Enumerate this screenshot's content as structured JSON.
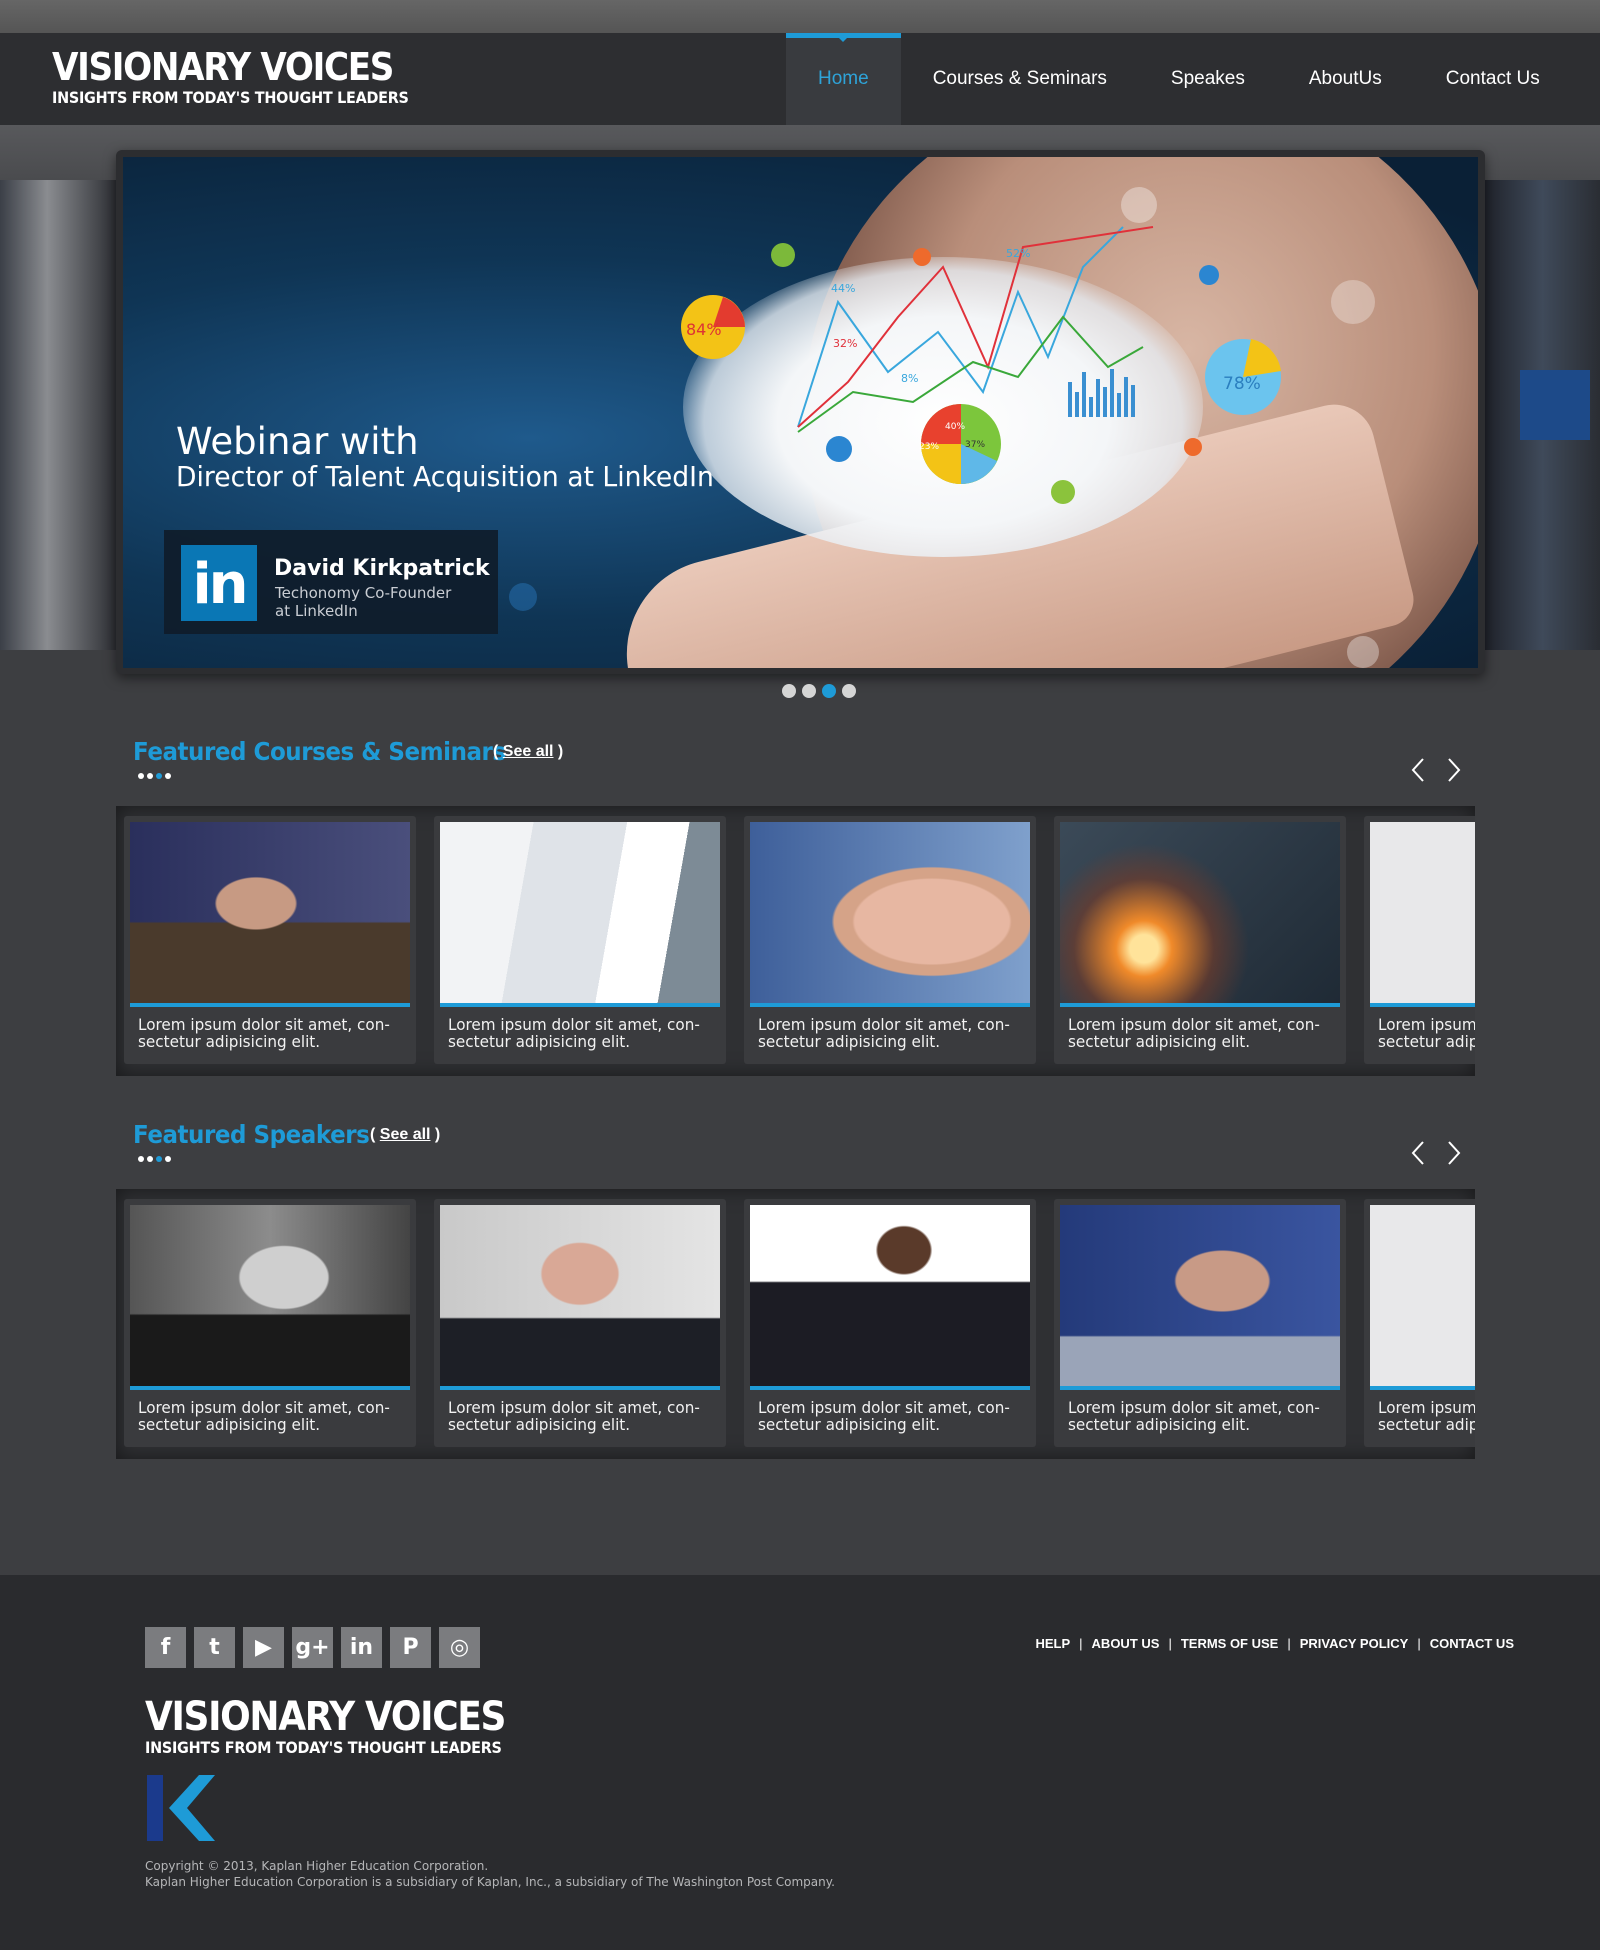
{
  "brand": {
    "title": "VISIONARY VOICES",
    "tagline": "INSIGHTS FROM TODAY'S THOUGHT LEADERS"
  },
  "nav": {
    "items": [
      {
        "label": "Home",
        "active": true
      },
      {
        "label": "Courses & Seminars",
        "active": false
      },
      {
        "label": "Speakes",
        "active": false
      },
      {
        "label": "AboutUs",
        "active": false
      },
      {
        "label": "Contact Us",
        "active": false
      }
    ]
  },
  "hero": {
    "title": "Webinar with",
    "subtitle": "Director of Talent Acquisition at LinkedIn",
    "badge_text": "in",
    "speaker_name": "David Kirkpatrick",
    "speaker_role": "Techonomy Co-Founder\nat LinkedIn",
    "chart_labels": [
      "84%",
      "78%",
      "44%",
      "52%",
      "32%",
      "8%",
      "40%",
      "23%",
      "37%"
    ],
    "slides_total": 4,
    "slide_active": 3
  },
  "courses": {
    "title": "Featured Courses & Seminars",
    "see_all": "See all",
    "items": [
      {
        "text": "Lorem ipsum dolor sit amet, con-sectetur adipisicing elit."
      },
      {
        "text": "Lorem ipsum dolor sit amet, con-sectetur adipisicing elit."
      },
      {
        "text": "Lorem ipsum dolor sit amet, con-sectetur adipisicing elit."
      },
      {
        "text": "Lorem ipsum dolor sit amet, con-sectetur adipisicing elit."
      },
      {
        "text": "Lorem ipsum dolor sit amet, con-sectetur adipisicing elit."
      }
    ]
  },
  "speakers": {
    "title": "Featured Speakers",
    "see_all": "See all",
    "items": [
      {
        "text": "Lorem ipsum dolor sit amet, con-sectetur adipisicing elit."
      },
      {
        "text": "Lorem ipsum dolor sit amet, con-sectetur adipisicing elit."
      },
      {
        "text": "Lorem ipsum dolor sit amet, con-sectetur adipisicing elit."
      },
      {
        "text": "Lorem ipsum dolor sit amet, con-sectetur adipisicing elit."
      },
      {
        "text": "Lorem ipsum dolor sit amet, con-sectetur adipisicing elit."
      }
    ]
  },
  "footer": {
    "social": [
      {
        "icon": "facebook-icon",
        "glyph": "f"
      },
      {
        "icon": "twitter-icon",
        "glyph": "t"
      },
      {
        "icon": "youtube-icon",
        "glyph": "▶"
      },
      {
        "icon": "googleplus-icon",
        "glyph": "g+"
      },
      {
        "icon": "linkedin-icon",
        "glyph": "in"
      },
      {
        "icon": "pinterest-icon",
        "glyph": "P"
      },
      {
        "icon": "idea-icon",
        "glyph": "◎"
      }
    ],
    "links": [
      "HELP",
      "ABOUT US",
      "TERMS OF USE",
      "PRIVACY POLICY",
      "CONTACT US"
    ],
    "copyright": "Copyright © 2013, Kaplan Higher Education Corporation.",
    "subsidiary": "Kaplan Higher Education Corporation is a subsidiary of Kaplan, Inc., a subsidiary of The Washington Post Company."
  },
  "colors": {
    "accent": "#1e9bd7",
    "nav_bg": "#2d2e31",
    "footer_bg": "#2a2b2e"
  }
}
